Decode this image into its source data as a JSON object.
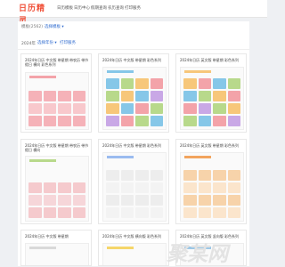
{
  "brand": {
    "logo": "日历精灵"
  },
  "nav": [
    "日历模板",
    "日历中心",
    "假期查询",
    "农历查询",
    "打印服务"
  ],
  "breadcrumb": "模板(2562)",
  "filters": {
    "label": "2024年",
    "select": "选择年份 ▾",
    "btn": "打印服务"
  },
  "section_select": "选择模板 ▾",
  "cards": [
    {
      "title": "2024年日历 中文版 带星期 带农历 带节假日 横向 彩色系列",
      "accent": "#f3a3a9"
    },
    {
      "title": "2024年日历 中文版 带星期 彩色系列",
      "accent": "#86c7e8"
    },
    {
      "title": "2024年日历 英文版 带星期 彩色系列",
      "accent": "#f7c77a"
    },
    {
      "title": "2024年日历 中文版 带星期 带农历 带节假日 横向",
      "accent": "#b8d98b"
    },
    {
      "title": "2024年日历 中文版 带星期 彩色系列",
      "accent": "#9bbcf0"
    },
    {
      "title": "2024年日历 英文版 带星期 彩色系列",
      "accent": "#f2a45e"
    },
    {
      "title": "2024年日历 中文版 带星期",
      "accent": "#d9d9d9"
    },
    {
      "title": "2024年日历 中文版 横向版 彩色系列",
      "accent": "#f5d66a"
    },
    {
      "title": "2024年日历 英文版 竖向版 彩色系列",
      "accent": "#9ec8e6"
    }
  ],
  "watermark": "聚某网"
}
